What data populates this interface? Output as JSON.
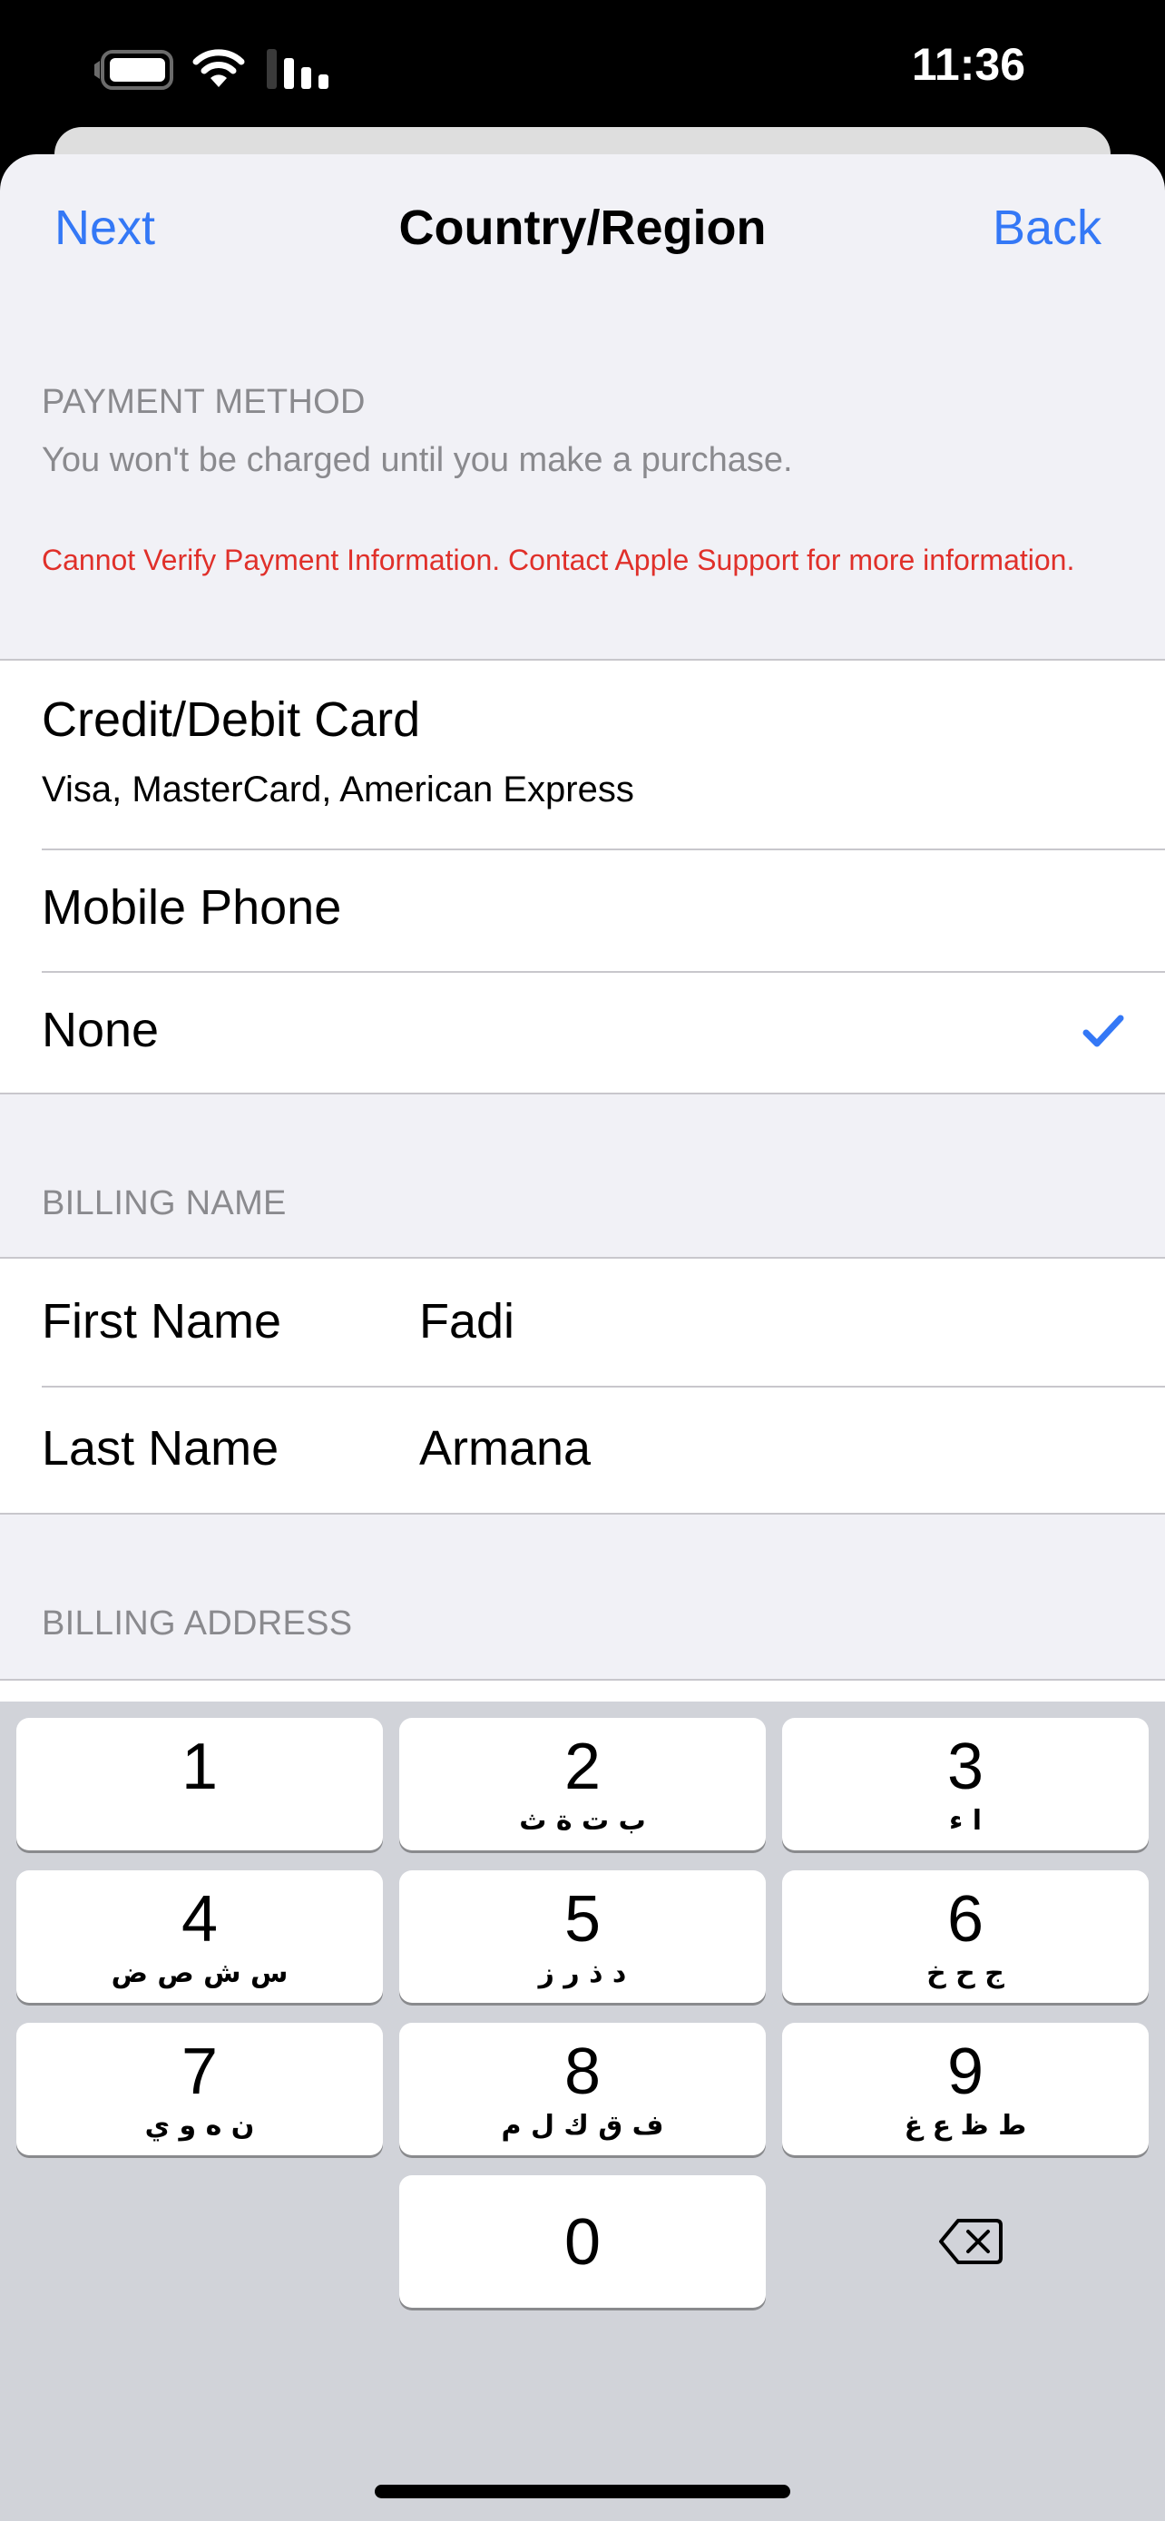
{
  "status_bar": {
    "time": "11:36",
    "icons": [
      "battery-icon",
      "wifi-icon",
      "cellular-signal-icon"
    ],
    "signal_bars_active": 3,
    "signal_bars_total": 4
  },
  "nav": {
    "left_button": "Next",
    "title": "Country/Region",
    "right_button": "Back"
  },
  "payment_method": {
    "header": "PAYMENT METHOD",
    "subheader": "You won't be charged until you make a purchase.",
    "error": "Cannot Verify Payment Information. Contact Apple Support for more information.",
    "options": [
      {
        "title": "Credit/Debit Card",
        "subtitle": "Visa, MasterCard, American Express",
        "selected": false
      },
      {
        "title": "Mobile Phone",
        "selected": false
      },
      {
        "title": "None",
        "selected": true,
        "icon": "checkmark-icon"
      }
    ]
  },
  "billing_name": {
    "header": "BILLING NAME",
    "fields": [
      {
        "label": "First Name",
        "value": "Fadi"
      },
      {
        "label": "Last Name",
        "value": "Armana"
      }
    ]
  },
  "billing_address": {
    "header": "BILLING ADDRESS"
  },
  "keypad": {
    "keys": [
      {
        "digit": "1",
        "letters": ""
      },
      {
        "digit": "2",
        "letters": "ب ت ة ث"
      },
      {
        "digit": "3",
        "letters": "ا ء"
      },
      {
        "digit": "4",
        "letters": "س ش ص ض"
      },
      {
        "digit": "5",
        "letters": "د ذ ر ز"
      },
      {
        "digit": "6",
        "letters": "ج ح خ"
      },
      {
        "digit": "7",
        "letters": "ن ه و ي"
      },
      {
        "digit": "8",
        "letters": "ف ق ك ل م"
      },
      {
        "digit": "9",
        "letters": "ط ظ ع غ"
      },
      {
        "digit": "0",
        "letters": ""
      }
    ],
    "delete_icon": "delete-backspace-icon"
  },
  "colors": {
    "accent": "#3478f6",
    "error": "#e0302a",
    "secondary_text": "#8a8a8e",
    "grouped_background": "#f1f1f6",
    "keypad_background": "#d1d3d9"
  }
}
